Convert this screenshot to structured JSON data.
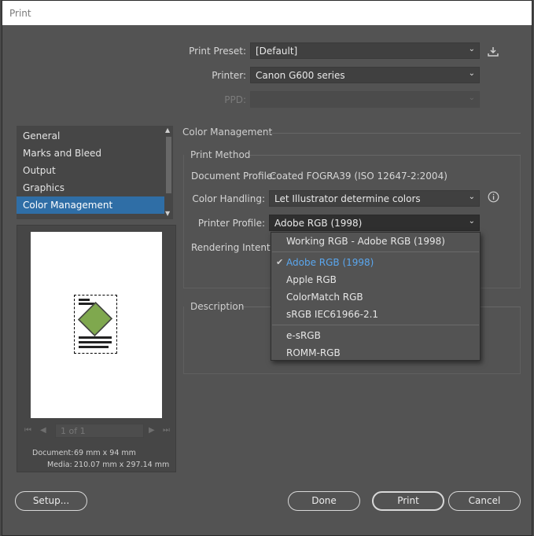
{
  "window": {
    "title": "Print"
  },
  "header": {
    "print_preset_label": "Print Preset:",
    "print_preset_value": "[Default]",
    "printer_label": "Printer:",
    "printer_value": "Canon G600 series",
    "ppd_label": "PPD:",
    "ppd_value": ""
  },
  "sidebar": {
    "items": [
      {
        "label": "General"
      },
      {
        "label": "Marks and Bleed"
      },
      {
        "label": "Output"
      },
      {
        "label": "Graphics"
      },
      {
        "label": "Color Management",
        "selected": true
      }
    ]
  },
  "preview": {
    "page_indicator": "1 of 1",
    "document_label": "Document:",
    "document_size": "69 mm x 94 mm",
    "media_label": "Media:",
    "media_size": "210.07 mm x 297.14 mm"
  },
  "color_management": {
    "title": "Color Management",
    "print_method_title": "Print Method",
    "document_profile_label": "Document Profile:",
    "document_profile_value": "Coated FOGRA39 (ISO 12647-2:2004)",
    "color_handling_label": "Color Handling:",
    "color_handling_value": "Let Illustrator determine colors",
    "printer_profile_label": "Printer Profile:",
    "printer_profile_value": "Adobe RGB (1998)",
    "rendering_intent_label": "Rendering Intent:",
    "description_title": "Description"
  },
  "printer_profile_options": [
    {
      "label": "Working RGB - Adobe RGB (1998)"
    },
    {
      "label": "Adobe RGB (1998)",
      "checked": true
    },
    {
      "label": "Apple RGB"
    },
    {
      "label": "ColorMatch RGB"
    },
    {
      "label": "sRGB IEC61966-2.1"
    },
    {
      "label": "e-sRGB"
    },
    {
      "label": "ROMM-RGB"
    }
  ],
  "footer": {
    "setup_label": "Setup...",
    "done_label": "Done",
    "print_label": "Print",
    "cancel_label": "Cancel"
  },
  "colors": {
    "selection": "#2f6ea6",
    "checked_item": "#5aa7ef",
    "panel": "#535353"
  },
  "icons": {
    "save_preset": "download-icon",
    "info": "info-icon",
    "checkmark": "checkmark-icon"
  }
}
